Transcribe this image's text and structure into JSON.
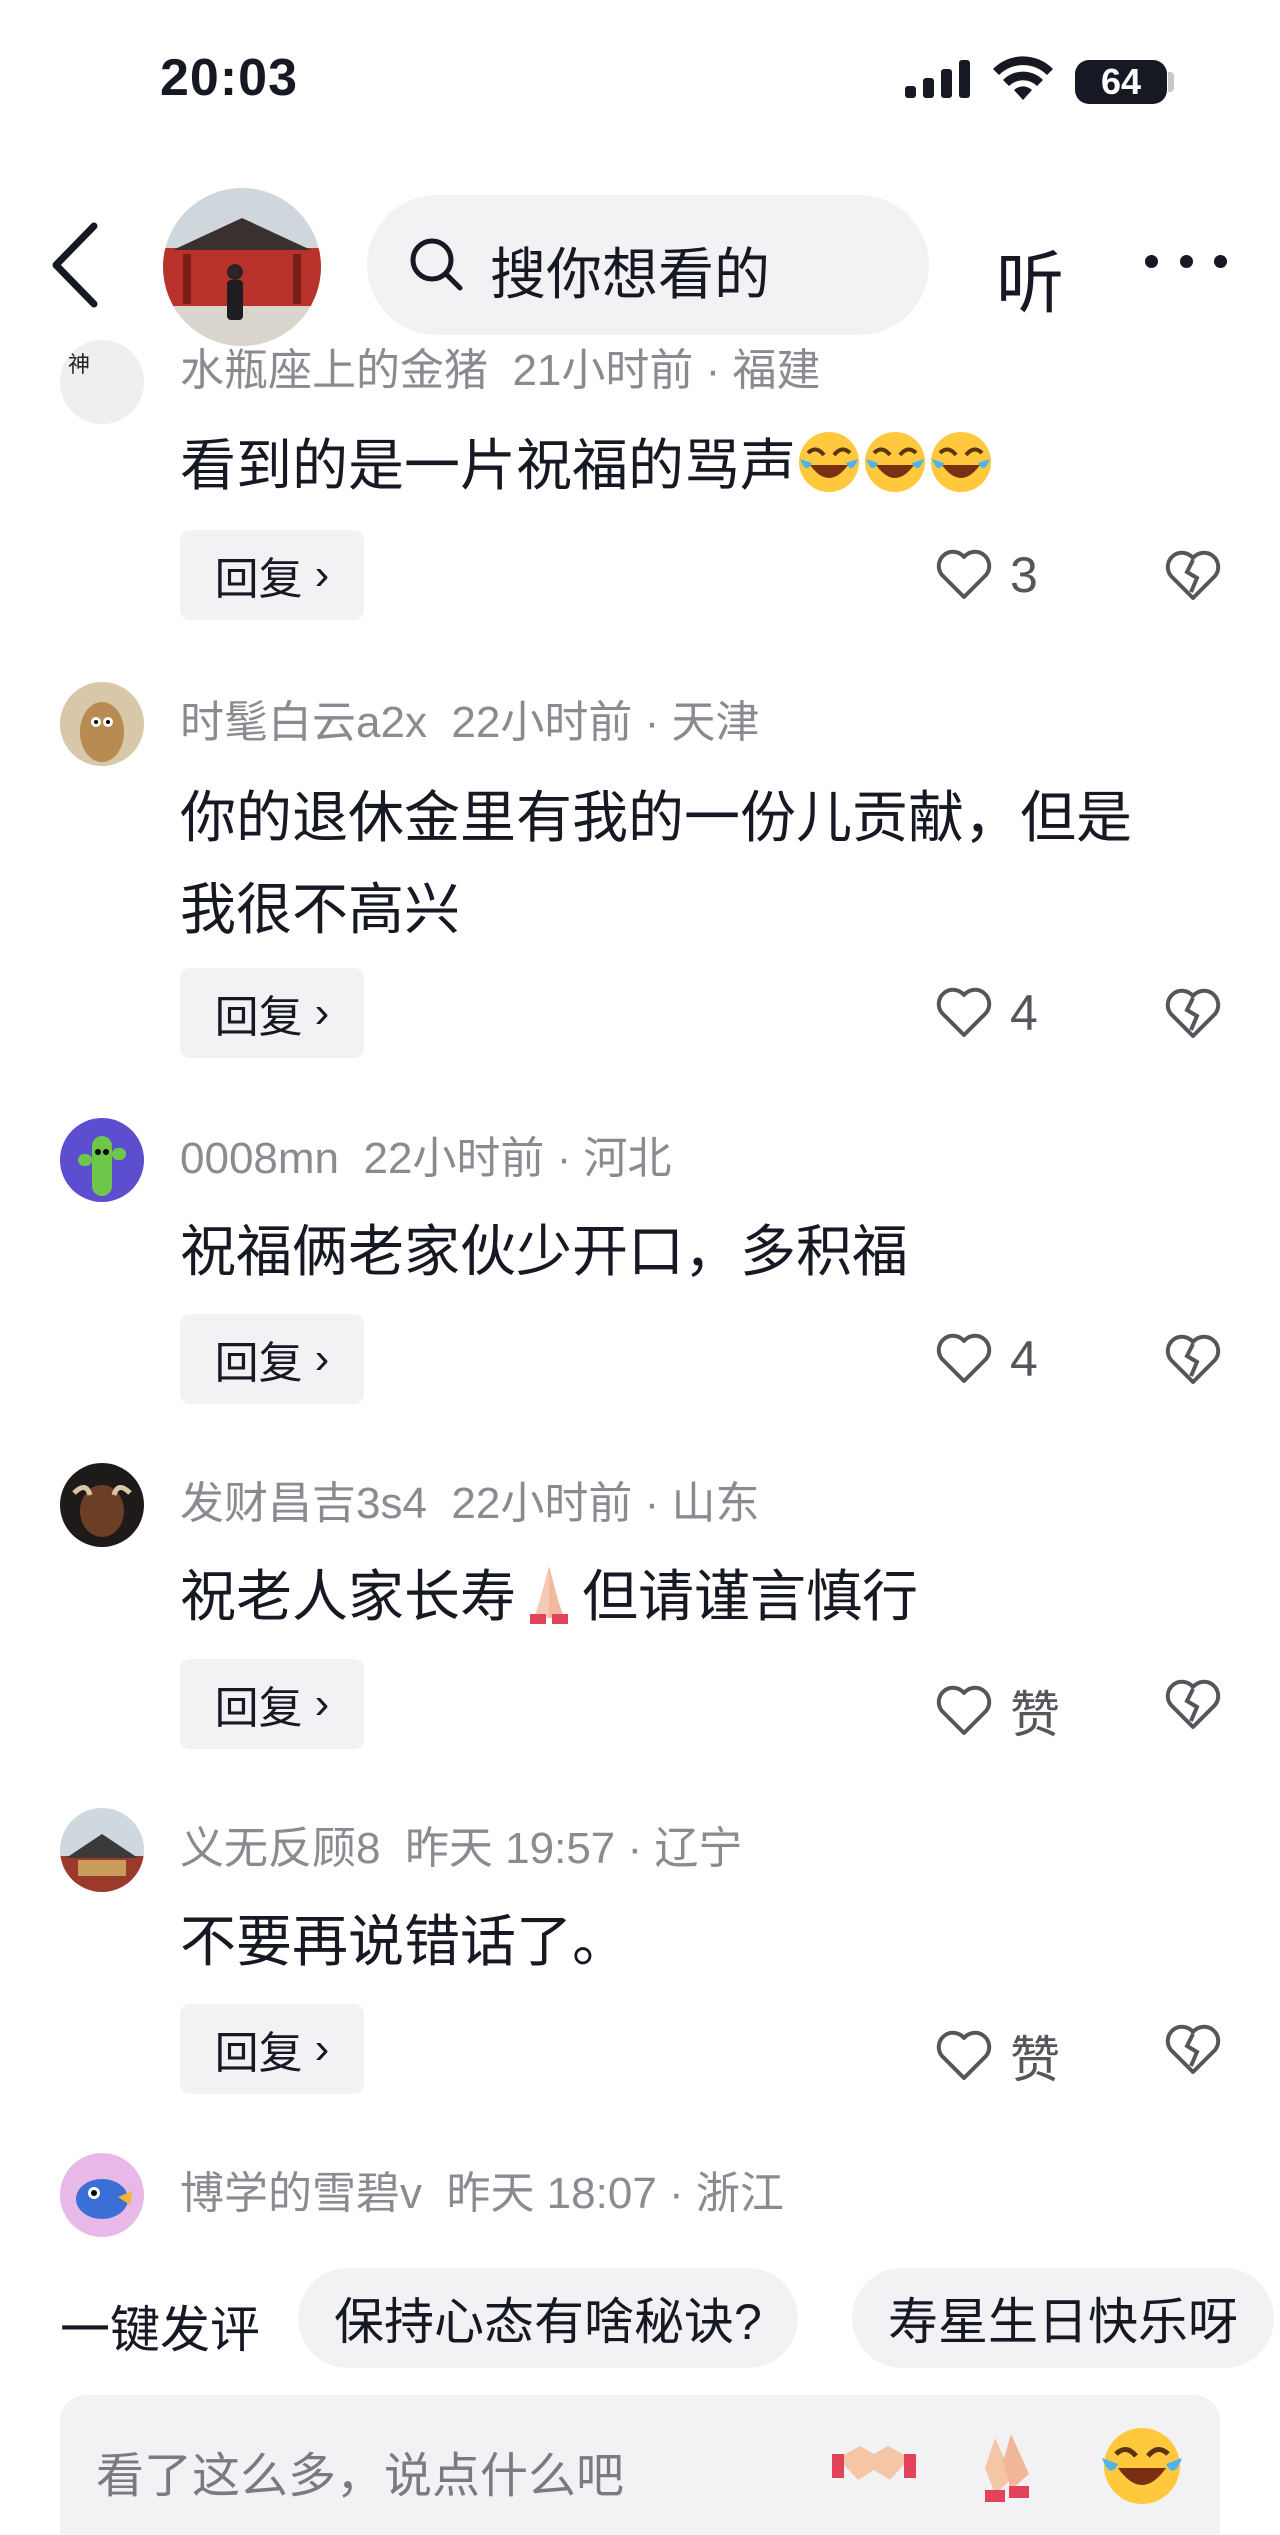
{
  "status_bar": {
    "time": "20:03",
    "battery": "64"
  },
  "nav": {
    "search_placeholder": "搜你想看的",
    "listen_label": "听"
  },
  "comments": [
    {
      "user": "水瓶座上的金猪",
      "time": "21小时前",
      "location": "福建",
      "text": "看到的是一片祝福的骂声",
      "emojis": [
        "laughing-crying",
        "laughing-crying",
        "laughing-crying"
      ],
      "likes": "3",
      "reply_label": "回复"
    },
    {
      "user": "时髦白云a2x",
      "time": "22小时前",
      "location": "天津",
      "text_line1": "你的退休金里有我的一份儿贡献，但是",
      "text_line2": "我很不高兴",
      "likes": "4",
      "reply_label": "回复"
    },
    {
      "user": "0008mn",
      "time": "22小时前",
      "location": "河北",
      "text": "祝福俩老家伙少开口，多积福",
      "likes": "4",
      "reply_label": "回复"
    },
    {
      "user": "发财昌吉3s4",
      "time": "22小时前",
      "location": "山东",
      "text_part1": "祝老人家长寿",
      "text_part2": "但请谨言慎行",
      "emojis": [
        "folded-hands"
      ],
      "likes": "赞",
      "reply_label": "回复"
    },
    {
      "user": "义无反顾8",
      "time": "昨天 19:57",
      "location": "辽宁",
      "text": "不要再说错话了。",
      "likes": "赞",
      "reply_label": "回复"
    },
    {
      "user": "博学的雪碧v",
      "time": "昨天 18:07",
      "location": "浙江"
    }
  ],
  "quick_comment": {
    "label": "一键发评",
    "chips": [
      "保持心态有啥秘诀?",
      "寿星生日快乐呀"
    ]
  },
  "input": {
    "placeholder": "看了这么多，说点什么吧",
    "emojis": [
      "handshake-icon",
      "clapping-icon",
      "laughing-crying-icon"
    ]
  },
  "colors": {
    "meta": "#8a8b91",
    "bg_chip": "#f2f2f4",
    "text": "#161823"
  }
}
